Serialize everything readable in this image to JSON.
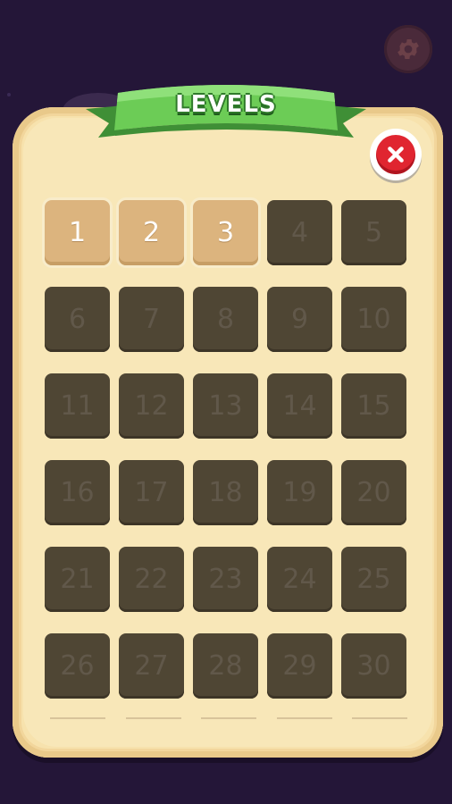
{
  "header": {
    "title": "LEVELS"
  },
  "buttons": {
    "settings_icon": "gear-icon",
    "close_icon": "close-icon"
  },
  "levels": [
    {
      "label": "1",
      "state": "unlocked"
    },
    {
      "label": "2",
      "state": "unlocked"
    },
    {
      "label": "3",
      "state": "unlocked"
    },
    {
      "label": "4",
      "state": "locked"
    },
    {
      "label": "5",
      "state": "locked"
    },
    {
      "label": "6",
      "state": "locked"
    },
    {
      "label": "7",
      "state": "locked"
    },
    {
      "label": "8",
      "state": "locked"
    },
    {
      "label": "9",
      "state": "locked"
    },
    {
      "label": "10",
      "state": "locked"
    },
    {
      "label": "11",
      "state": "locked"
    },
    {
      "label": "12",
      "state": "locked"
    },
    {
      "label": "13",
      "state": "locked"
    },
    {
      "label": "14",
      "state": "locked"
    },
    {
      "label": "15",
      "state": "locked"
    },
    {
      "label": "16",
      "state": "locked"
    },
    {
      "label": "17",
      "state": "locked"
    },
    {
      "label": "18",
      "state": "locked"
    },
    {
      "label": "19",
      "state": "locked"
    },
    {
      "label": "20",
      "state": "locked"
    },
    {
      "label": "21",
      "state": "locked"
    },
    {
      "label": "22",
      "state": "locked"
    },
    {
      "label": "23",
      "state": "locked"
    },
    {
      "label": "24",
      "state": "locked"
    },
    {
      "label": "25",
      "state": "locked"
    },
    {
      "label": "26",
      "state": "locked"
    },
    {
      "label": "27",
      "state": "locked"
    },
    {
      "label": "28",
      "state": "locked"
    },
    {
      "label": "29",
      "state": "locked"
    },
    {
      "label": "30",
      "state": "locked"
    }
  ],
  "colors": {
    "background": "#241638",
    "panel": "#f7e2ad",
    "ribbon_green": "#5cc04a",
    "unlocked_tile": "#dcb47e",
    "locked_tile": "#4f4634",
    "close_red": "#e02530"
  }
}
